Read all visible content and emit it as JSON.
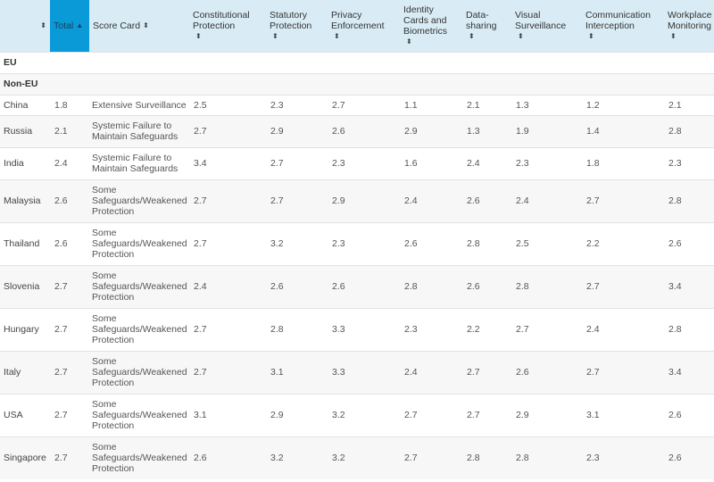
{
  "table": {
    "headers": [
      {
        "label": "",
        "sort": "none"
      },
      {
        "label": "Total",
        "sort": "asc",
        "active": true
      },
      {
        "label": "Score Card",
        "sort": "none"
      },
      {
        "label": "Constitutional Protection",
        "sort": "none"
      },
      {
        "label": "Statutory Protection",
        "sort": "none"
      },
      {
        "label": "Privacy Enforcement",
        "sort": "none"
      },
      {
        "label": "Identity Cards and Biometrics",
        "sort": "none"
      },
      {
        "label": "Data-sharing",
        "sort": "none"
      },
      {
        "label": "Visual Surveillance",
        "sort": "none"
      },
      {
        "label": "Communication Interception",
        "sort": "none"
      },
      {
        "label": "Workplace Monitoring",
        "sort": "none"
      }
    ],
    "sort_icons": {
      "unsorted": "⬍",
      "asc": "▲"
    },
    "groups": [
      {
        "label": "EU"
      },
      {
        "label": "Non-EU"
      }
    ],
    "rows": [
      {
        "country": "China",
        "total": "1.8",
        "score_card": "Extensive Surveillance",
        "constitutional": "2.5",
        "statutory": "2.3",
        "privacy": "2.7",
        "identity": "1.1",
        "data_sharing": "2.1",
        "visual": "1.3",
        "communication": "1.2",
        "workplace": "2.1"
      },
      {
        "country": "Russia",
        "total": "2.1",
        "score_card": "Systemic Failure to Maintain Safeguards",
        "constitutional": "2.7",
        "statutory": "2.9",
        "privacy": "2.6",
        "identity": "2.9",
        "data_sharing": "1.3",
        "visual": "1.9",
        "communication": "1.4",
        "workplace": "2.8"
      },
      {
        "country": "India",
        "total": "2.4",
        "score_card": "Systemic Failure to Maintain Safeguards",
        "constitutional": "3.4",
        "statutory": "2.7",
        "privacy": "2.3",
        "identity": "1.6",
        "data_sharing": "2.4",
        "visual": "2.3",
        "communication": "1.8",
        "workplace": "2.3"
      },
      {
        "country": "Malaysia",
        "total": "2.6",
        "score_card": "Some Safeguards/Weakened Protection",
        "constitutional": "2.7",
        "statutory": "2.7",
        "privacy": "2.9",
        "identity": "2.4",
        "data_sharing": "2.6",
        "visual": "2.4",
        "communication": "2.7",
        "workplace": "2.8"
      },
      {
        "country": "Thailand",
        "total": "2.6",
        "score_card": "Some Safeguards/Weakened Protection",
        "constitutional": "2.7",
        "statutory": "3.2",
        "privacy": "2.3",
        "identity": "2.6",
        "data_sharing": "2.8",
        "visual": "2.5",
        "communication": "2.2",
        "workplace": "2.6"
      },
      {
        "country": "Slovenia",
        "total": "2.7",
        "score_card": "Some Safeguards/Weakened Protection",
        "constitutional": "2.4",
        "statutory": "2.6",
        "privacy": "2.6",
        "identity": "2.8",
        "data_sharing": "2.6",
        "visual": "2.8",
        "communication": "2.7",
        "workplace": "3.4"
      },
      {
        "country": "Hungary",
        "total": "2.7",
        "score_card": "Some Safeguards/Weakened Protection",
        "constitutional": "2.7",
        "statutory": "2.8",
        "privacy": "3.3",
        "identity": "2.3",
        "data_sharing": "2.2",
        "visual": "2.7",
        "communication": "2.4",
        "workplace": "2.8"
      },
      {
        "country": "Italy",
        "total": "2.7",
        "score_card": "Some Safeguards/Weakened Protection",
        "constitutional": "2.7",
        "statutory": "3.1",
        "privacy": "3.3",
        "identity": "2.4",
        "data_sharing": "2.7",
        "visual": "2.6",
        "communication": "2.7",
        "workplace": "3.4"
      },
      {
        "country": "USA",
        "total": "2.7",
        "score_card": "Some Safeguards/Weakened Protection",
        "constitutional": "3.1",
        "statutory": "2.9",
        "privacy": "3.2",
        "identity": "2.7",
        "data_sharing": "2.7",
        "visual": "2.9",
        "communication": "3.1",
        "workplace": "2.6"
      },
      {
        "country": "Singapore",
        "total": "2.7",
        "score_card": "Some Safeguards/Weakened Protection",
        "constitutional": "2.6",
        "statutory": "3.2",
        "privacy": "3.2",
        "identity": "2.7",
        "data_sharing": "2.8",
        "visual": "2.8",
        "communication": "2.3",
        "workplace": "2.6"
      }
    ]
  },
  "colors": {
    "header_bg": "#d9ecf5",
    "active_header_bg": "#0a9ad8",
    "row_alt_bg": "#f7f7f7"
  }
}
